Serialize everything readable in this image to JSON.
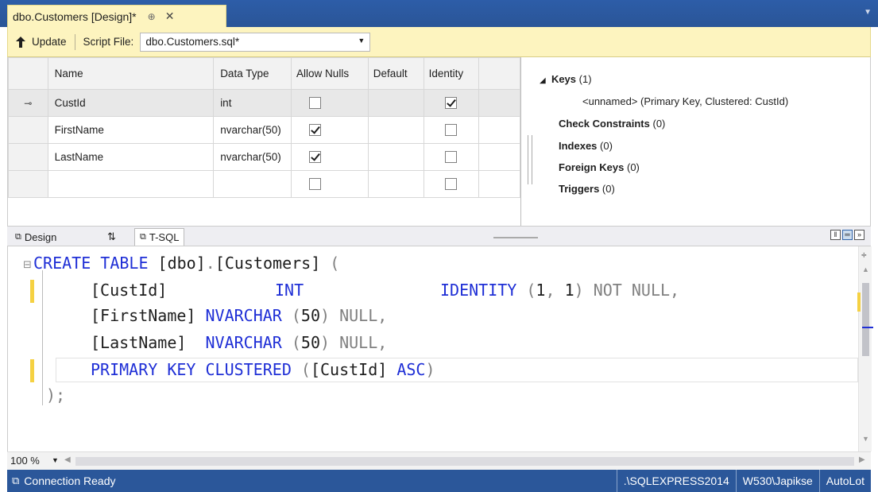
{
  "document_tab": {
    "title": "dbo.Customers [Design]*",
    "pin_glyph": "⊕",
    "close_glyph": "✕"
  },
  "toolbar": {
    "update_label": "Update",
    "script_file_label": "Script File:",
    "script_file_value": "dbo.Customers.sql*"
  },
  "grid": {
    "columns": [
      "Name",
      "Data Type",
      "Allow Nulls",
      "Default",
      "Identity"
    ],
    "rows": [
      {
        "key": true,
        "name": "CustId",
        "type": "int",
        "nulls": false,
        "default": "",
        "identity": true
      },
      {
        "key": false,
        "name": "FirstName",
        "type": "nvarchar(50)",
        "nulls": true,
        "default": "",
        "identity": false
      },
      {
        "key": false,
        "name": "LastName",
        "type": "nvarchar(50)",
        "nulls": true,
        "default": "",
        "identity": false
      },
      {
        "key": false,
        "name": "",
        "type": "",
        "nulls": false,
        "default": "",
        "identity": false
      }
    ]
  },
  "properties": {
    "keys_label": "Keys",
    "keys_count": "(1)",
    "key_item": "<unnamed>   (Primary Key, Clustered: CustId)",
    "check_label": "Check Constraints",
    "check_count": "(0)",
    "indexes_label": "Indexes",
    "indexes_count": "(0)",
    "fk_label": "Foreign Keys",
    "fk_count": "(0)",
    "triggers_label": "Triggers",
    "triggers_count": "(0)"
  },
  "pane_tabs": {
    "design": "Design",
    "swap": "⇅",
    "tsql": "T-SQL"
  },
  "code": {
    "l1a": "CREATE TABLE ",
    "l1b": "[dbo]",
    "l1c": ".",
    "l1d": "[Customers]",
    "l1e": " (",
    "l2a": "[CustId]",
    "l2b": "INT",
    "l2c": "IDENTITY ",
    "l2d": "(",
    "l2e": "1",
    "l2f": ", ",
    "l2g": "1",
    "l2h": ") NOT NULL,",
    "l3a": "[FirstName] ",
    "l3b": "NVARCHAR ",
    "l3c": "(",
    "l3d": "50",
    "l3e": ") NULL,",
    "l4a": "[LastName]  ",
    "l4b": "NVARCHAR ",
    "l4c": "(",
    "l4d": "50",
    "l4e": ") NULL,",
    "l5a": "PRIMARY KEY CLUSTERED ",
    "l5b": "(",
    "l5c": "[CustId]",
    "l5d": " ASC",
    "l5e": ")",
    "l6": ");"
  },
  "zoom": "100 %",
  "status": {
    "message": "Connection Ready",
    "server": ".\\SQLEXPRESS2014",
    "user": "W530\\Japikse",
    "database": "AutoLot"
  }
}
